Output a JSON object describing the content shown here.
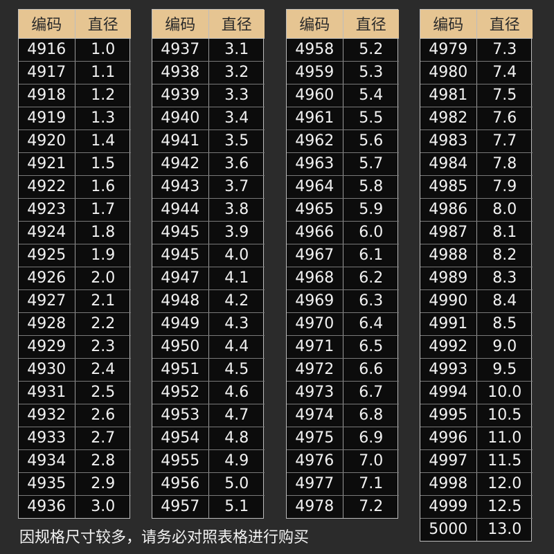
{
  "headers": {
    "code": "编码",
    "diameter": "直径"
  },
  "tables": [
    {
      "rows": [
        [
          "4916",
          "1.0"
        ],
        [
          "4917",
          "1.1"
        ],
        [
          "4918",
          "1.2"
        ],
        [
          "4919",
          "1.3"
        ],
        [
          "4920",
          "1.4"
        ],
        [
          "4921",
          "1.5"
        ],
        [
          "4922",
          "1.6"
        ],
        [
          "4923",
          "1.7"
        ],
        [
          "4924",
          "1.8"
        ],
        [
          "4925",
          "1.9"
        ],
        [
          "4926",
          "2.0"
        ],
        [
          "4927",
          "2.1"
        ],
        [
          "4928",
          "2.2"
        ],
        [
          "4929",
          "2.3"
        ],
        [
          "4930",
          "2.4"
        ],
        [
          "4931",
          "2.5"
        ],
        [
          "4932",
          "2.6"
        ],
        [
          "4933",
          "2.7"
        ],
        [
          "4934",
          "2.8"
        ],
        [
          "4935",
          "2.9"
        ],
        [
          "4936",
          "3.0"
        ]
      ]
    },
    {
      "rows": [
        [
          "4937",
          "3.1"
        ],
        [
          "4938",
          "3.2"
        ],
        [
          "4939",
          "3.3"
        ],
        [
          "4940",
          "3.4"
        ],
        [
          "4941",
          "3.5"
        ],
        [
          "4942",
          "3.6"
        ],
        [
          "4943",
          "3.7"
        ],
        [
          "4944",
          "3.8"
        ],
        [
          "4945",
          "3.9"
        ],
        [
          "4945",
          "4.0"
        ],
        [
          "4947",
          "4.1"
        ],
        [
          "4948",
          "4.2"
        ],
        [
          "4949",
          "4.3"
        ],
        [
          "4950",
          "4.4"
        ],
        [
          "4951",
          "4.5"
        ],
        [
          "4952",
          "4.6"
        ],
        [
          "4953",
          "4.7"
        ],
        [
          "4954",
          "4.8"
        ],
        [
          "4955",
          "4.9"
        ],
        [
          "4956",
          "5.0"
        ],
        [
          "4957",
          "5.1"
        ]
      ]
    },
    {
      "rows": [
        [
          "4958",
          "5.2"
        ],
        [
          "4959",
          "5.3"
        ],
        [
          "4960",
          "5.4"
        ],
        [
          "4961",
          "5.5"
        ],
        [
          "4962",
          "5.6"
        ],
        [
          "4963",
          "5.7"
        ],
        [
          "4964",
          "5.8"
        ],
        [
          "4965",
          "5.9"
        ],
        [
          "4966",
          "6.0"
        ],
        [
          "4967",
          "6.1"
        ],
        [
          "4968",
          "6.2"
        ],
        [
          "4969",
          "6.3"
        ],
        [
          "4970",
          "6.4"
        ],
        [
          "4971",
          "6.5"
        ],
        [
          "4972",
          "6.6"
        ],
        [
          "4973",
          "6.7"
        ],
        [
          "4974",
          "6.8"
        ],
        [
          "4975",
          "6.9"
        ],
        [
          "4976",
          "7.0"
        ],
        [
          "4977",
          "7.1"
        ],
        [
          "4978",
          "7.2"
        ]
      ]
    },
    {
      "rows": [
        [
          "4979",
          "7.3"
        ],
        [
          "4980",
          "7.4"
        ],
        [
          "4981",
          "7.5"
        ],
        [
          "4982",
          "7.6"
        ],
        [
          "4983",
          "7.7"
        ],
        [
          "4984",
          "7.8"
        ],
        [
          "4985",
          "7.9"
        ],
        [
          "4986",
          "8.0"
        ],
        [
          "4987",
          "8.1"
        ],
        [
          "4988",
          "8.2"
        ],
        [
          "4989",
          "8.3"
        ],
        [
          "4990",
          "8.4"
        ],
        [
          "4991",
          "8.5"
        ],
        [
          "4992",
          "9.0"
        ],
        [
          "4993",
          "9.5"
        ],
        [
          "4994",
          "10.0"
        ],
        [
          "4995",
          "10.5"
        ],
        [
          "4996",
          "11.0"
        ],
        [
          "4997",
          "11.5"
        ],
        [
          "4998",
          "12.0"
        ],
        [
          "4999",
          "12.5"
        ],
        [
          "5000",
          "13.0"
        ]
      ]
    }
  ],
  "note": "因规格尺寸较多，请务必对照表格进行购买",
  "colors": {
    "background": "#2b2b2b",
    "header": "#e6c592",
    "table": "#0c0c0c"
  }
}
